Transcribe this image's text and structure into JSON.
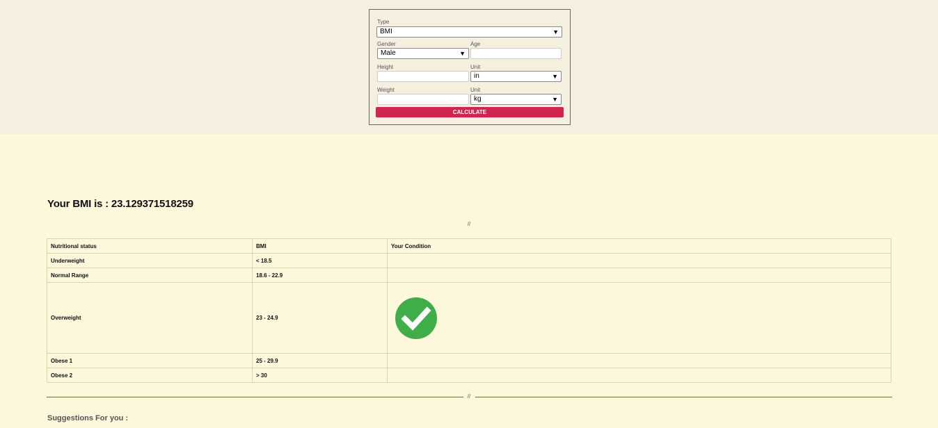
{
  "form": {
    "type_label": "Type",
    "type_value": "BMI",
    "gender_label": "Gender",
    "gender_value": "Male",
    "age_label": "Age",
    "age_value": "",
    "height_label": "Height",
    "height_value": "",
    "height_unit_label": "Unit",
    "height_unit_value": "in",
    "weight_label": "Weight",
    "weight_value": "",
    "weight_unit_label": "Unit",
    "weight_unit_value": "kg",
    "calculate_label": "CALCULATE",
    "dropdown_arrow": "▼",
    "button_color": "#cf2550"
  },
  "result": {
    "title": "Your BMI is : 23.129371518259",
    "divider": "//"
  },
  "table": {
    "headers": [
      "Nutritional status",
      "BMI",
      "Your Condition"
    ],
    "rows": [
      {
        "status": "Underweight",
        "bmi": "< 18.5"
      },
      {
        "status": "Normal Range",
        "bmi": "18.6 - 22.9"
      },
      {
        "status": "Overweight",
        "bmi": "23 - 24.9",
        "check_icon": "check-circle-icon"
      },
      {
        "status": "Obese 1",
        "bmi": "25 - 29.9"
      },
      {
        "status": "Obese 2",
        "bmi": "> 30"
      }
    ],
    "check_color": "#3fae49"
  },
  "footer": {
    "divider": "//",
    "suggestions_label": "Suggestions For you :"
  }
}
